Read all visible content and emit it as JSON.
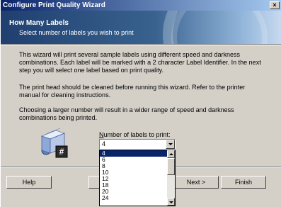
{
  "window": {
    "title": "Configure Print Quality Wizard",
    "close_glyph": "×"
  },
  "header": {
    "title": "How Many Labels",
    "subtitle": "Select number of labels you wish to print"
  },
  "body": {
    "para1": "This wizard will print several sample labels using different speed and darkness combinations. Each label will be marked with a 2 character Label Identifier. In the next step you will select one label based on print quality.",
    "para2": "The print head should be cleaned before running this wizard. Refer to the printer manual for cleaning instructions.",
    "para3": "Choosing a larger number will result in a wider range of speed and darkness combinations being printed."
  },
  "labels_count": {
    "label_prefix": "N",
    "label_rest": "umber of labels to print:",
    "selected": "4",
    "options": [
      "4",
      "6",
      "8",
      "10",
      "12",
      "18",
      "20",
      "24"
    ]
  },
  "buttons": {
    "help": "Help",
    "back": "",
    "next": "Next >",
    "finish": "Finish"
  },
  "icons": {
    "label_icon_glyph": "#"
  },
  "colors": {
    "title_bar": "#0a246a",
    "selection": "#0a246a",
    "header_dark": "#1f3f6f"
  }
}
